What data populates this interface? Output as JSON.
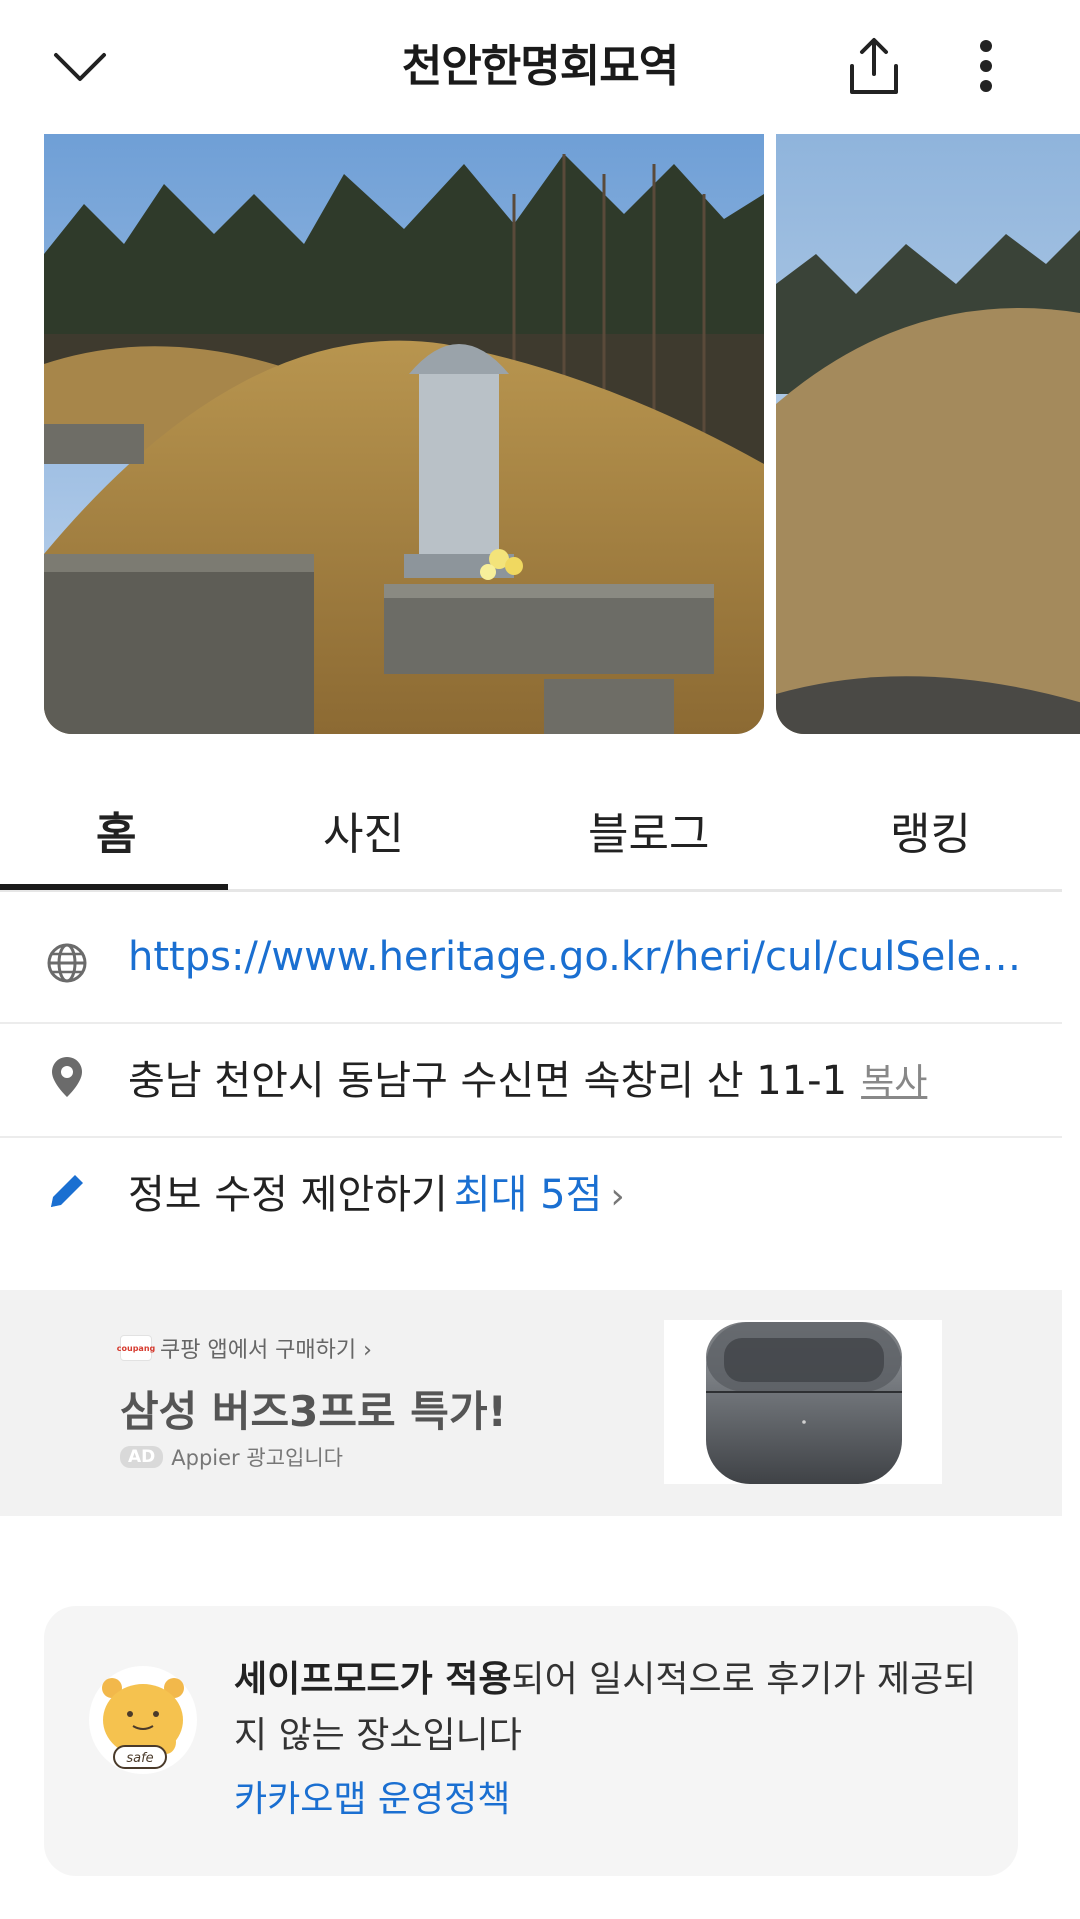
{
  "header": {
    "title": "천안한명회묘역",
    "back_icon": "chevron-down-icon",
    "share_icon": "share-icon",
    "more_icon": "more-vertical-icon"
  },
  "tabs": [
    {
      "label": "홈",
      "active": true
    },
    {
      "label": "사진",
      "active": false
    },
    {
      "label": "블로그",
      "active": false
    },
    {
      "label": "랭킹",
      "active": false
    }
  ],
  "info": {
    "url": "https://www.heritage.go.kr/heri/cul/culSelectD…",
    "address": "충남 천안시 동남구 수신면 속창리 산 11-1",
    "copy_label": "복사",
    "edit_label": "정보 수정 제안하기",
    "edit_points": "최대 5점",
    "edit_chevron": "›"
  },
  "ad": {
    "logo_text": "coupang",
    "brand_text": "쿠팡 앱에서 구매하기 ›",
    "headline": "삼성 버즈3프로 특가!",
    "badge": "AD",
    "source": "Appier 광고입니다"
  },
  "safe_mode": {
    "bold_text": "세이프모드가 적용",
    "text": "되어 일시적으로 후기가 제공되지 않는 장소입니다",
    "link": "카카오맵 운영정책",
    "avatar_label": "safe"
  },
  "colors": {
    "link_blue": "#1a6fd1",
    "tab_indicator": "#1a1a1a",
    "ad_bg": "#f2f2f2"
  }
}
